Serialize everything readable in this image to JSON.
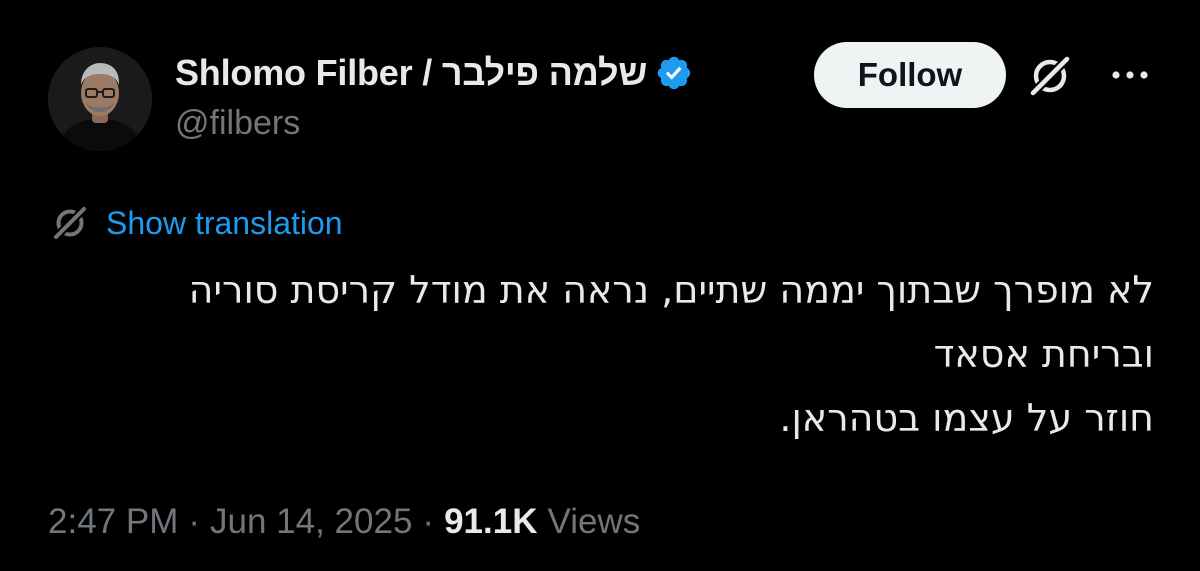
{
  "author": {
    "display_name": "Shlomo Filber / שלמה פילבר",
    "handle": "@filbers",
    "verified_icon": "verified-badge-icon",
    "avatar_icon": "profile-photo"
  },
  "actions": {
    "follow_label": "Follow",
    "grok_icon": "grok-icon",
    "more_icon": "more-options-icon"
  },
  "translation": {
    "label": "Show translation",
    "icon": "translate-icon"
  },
  "tweet": {
    "lines": [
      "לא מופרך שבתוך יממה שתיים, נראה את מודל קריסת סוריה",
      "ובריחת אסאד",
      "חוזר על עצמו בטהראן."
    ]
  },
  "meta": {
    "time": "2:47 PM",
    "separator": "·",
    "date": "Jun 14, 2025",
    "views_count": "91.1K",
    "views_label": "Views"
  },
  "colors": {
    "background": "#000000",
    "primary_text": "#e7e9ea",
    "secondary_text": "#71767b",
    "link": "#1d9bf0",
    "verified": "#1d9bf0",
    "follow_bg": "#eff3f4"
  }
}
